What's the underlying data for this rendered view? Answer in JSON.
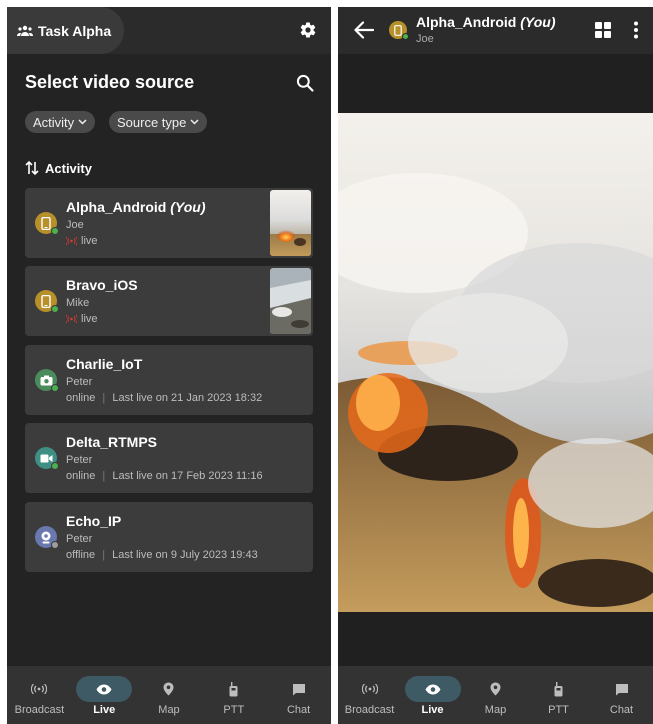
{
  "left": {
    "team_name": "Task Alpha",
    "section_title": "Select video source",
    "filters": [
      "Activity",
      "Source type"
    ],
    "sort_label": "Activity",
    "sources": [
      {
        "name": "Alpha_Android",
        "you": "(You)",
        "user": "Joe",
        "status": "live",
        "last_live": "",
        "icon": "phone-icon",
        "color": "#b8902a",
        "dot": "#4caf50"
      },
      {
        "name": "Bravo_iOS",
        "you": "",
        "user": "Mike",
        "status": "live",
        "last_live": "",
        "icon": "phone-icon",
        "color": "#b8902a",
        "dot": "#4caf50"
      },
      {
        "name": "Charlie_IoT",
        "you": "",
        "user": "Peter",
        "status": "online",
        "last_live": "Last live on 21 Jan 2023 18:32",
        "icon": "camera-icon",
        "color": "#4a8c5c",
        "dot": "#4caf50"
      },
      {
        "name": "Delta_RTMPS",
        "you": "",
        "user": "Peter",
        "status": "online",
        "last_live": "Last live on 17 Feb 2023 11:16",
        "icon": "video-camera-icon",
        "color": "#3f8f84",
        "dot": "#4caf50"
      },
      {
        "name": "Echo_IP",
        "you": "",
        "user": "Peter",
        "status": "offline",
        "last_live": "Last live on 9 July 2023 19:43",
        "icon": "webcam-icon",
        "color": "#6a78b0",
        "dot": "#9e9e9e"
      }
    ]
  },
  "right": {
    "title": "Alpha_Android",
    "you": "(You)",
    "subtitle": "Joe"
  },
  "nav": [
    {
      "label": "Broadcast",
      "icon": "broadcast-icon"
    },
    {
      "label": "Live",
      "icon": "eye-icon",
      "active": true
    },
    {
      "label": "Map",
      "icon": "map-pin-icon"
    },
    {
      "label": "PTT",
      "icon": "walkie-talkie-icon"
    },
    {
      "label": "Chat",
      "icon": "chat-icon"
    }
  ],
  "colors": {
    "accent_active": "#3e5a64",
    "live_red": "#e53935",
    "online_green": "#4caf50"
  }
}
